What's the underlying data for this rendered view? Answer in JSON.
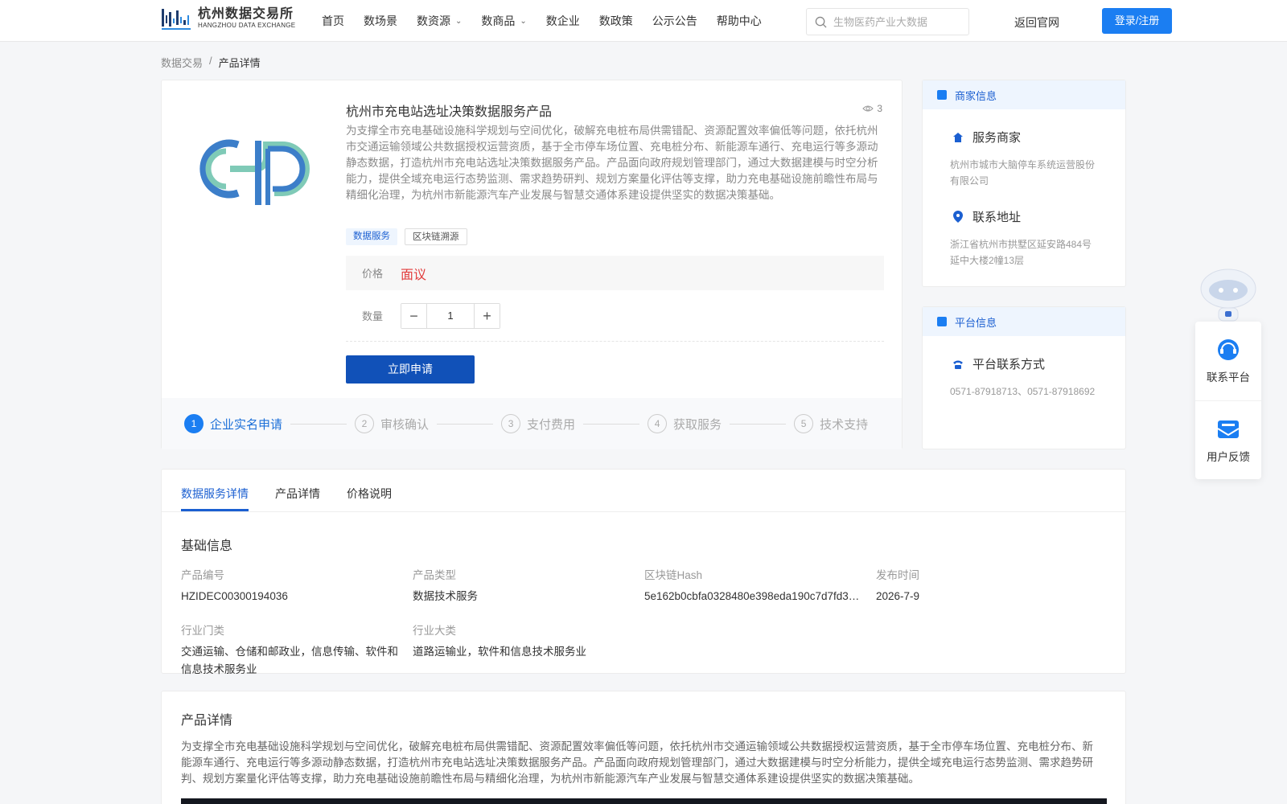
{
  "header": {
    "logo_cn": "杭州数据交易所",
    "logo_en": "HANGZHOU DATA EXCHANGE",
    "nav": [
      {
        "label": "首页",
        "dropdown": false
      },
      {
        "label": "数场景",
        "dropdown": false
      },
      {
        "label": "数资源",
        "dropdown": true
      },
      {
        "label": "数商品",
        "dropdown": true
      },
      {
        "label": "数企业",
        "dropdown": false
      },
      {
        "label": "数政策",
        "dropdown": false
      },
      {
        "label": "公示公告",
        "dropdown": false
      },
      {
        "label": "帮助中心",
        "dropdown": false
      }
    ],
    "search_placeholder": "生物医药产业大数据",
    "back_site": "返回官网",
    "login": "登录/注册"
  },
  "breadcrumb": {
    "root": "数据交易",
    "sep": "/",
    "current": "产品详情"
  },
  "product": {
    "title": "杭州市充电站选址决策数据服务产品",
    "views": "3",
    "description": "为支撑全市充电基础设施科学规划与空间优化，破解充电桩布局供需错配、资源配置效率偏低等问题，依托杭州市交通运输领域公共数据授权运营资质，基于全市停车场位置、充电桩分布、新能源车通行、充电运行等多源动静态数据，打造杭州市充电站选址决策数据服务产品。产品面向政府规划管理部门，通过大数据建模与时空分析能力，提供全域充电运行态势监测、需求趋势研判、规划方案量化评估等支撑，助力充电基础设施前瞻性布局与精细化治理，为杭州市新能源汽车产业发展与智慧交通体系建设提供坚实的数据决策基础。",
    "tags": [
      "数据服务",
      "区块链溯源"
    ],
    "price_label": "价格",
    "price_value": "面议",
    "qty_label": "数量",
    "qty_value": "1",
    "apply": "立即申请",
    "steps": [
      {
        "num": "1",
        "label": "企业实名申请"
      },
      {
        "num": "2",
        "label": "审核确认"
      },
      {
        "num": "3",
        "label": "支付费用"
      },
      {
        "num": "4",
        "label": "获取服务"
      },
      {
        "num": "5",
        "label": "技术支持"
      }
    ],
    "active_step": 1
  },
  "merchant": {
    "head": "商家信息",
    "service_title": "服务商家",
    "service_value": "杭州市城市大脑停车系统运营股份有限公司",
    "address_title": "联系地址",
    "address_value": "浙江省杭州市拱墅区延安路484号延中大楼2幢13层"
  },
  "platform": {
    "head": "平台信息",
    "contact_title": "平台联系方式",
    "contact_value": "0571-87918713、0571-87918692"
  },
  "tabs": [
    "数据服务详情",
    "产品详情",
    "价格说明"
  ],
  "basic": {
    "title": "基础信息",
    "fields": [
      {
        "k": "产品编号",
        "v": "HZIDEC00300194036"
      },
      {
        "k": "产品类型",
        "v": "数据技术服务"
      },
      {
        "k": "区块链Hash",
        "v": "5e162b0cbfa0328480e398eda190c7d7fd3…"
      },
      {
        "k": "发布时间",
        "v": "2026-7-9"
      },
      {
        "k": "行业门类",
        "v": "交通运输、仓储和邮政业，信息传输、软件和信息技术服务业"
      },
      {
        "k": "行业大类",
        "v": "道路运输业，软件和信息技术服务业"
      }
    ]
  },
  "product_detail": {
    "title": "产品详情",
    "text": "为支撑全市充电基础设施科学规划与空间优化，破解充电桩布局供需错配、资源配置效率偏低等问题，依托杭州市交通运输领域公共数据授权运营资质，基于全市停车场位置、充电桩分布、新能源车通行、充电运行等多源动静态数据，打造杭州市充电站选址决策数据服务产品。产品面向政府规划管理部门，通过大数据建模与时空分析能力，提供全域充电运行态势监测、需求趋势研判、规划方案量化评估等支撑，助力充电基础设施前瞻性布局与精细化治理，为杭州市新能源汽车产业发展与智慧交通体系建设提供坚实的数据决策基础。"
  },
  "float": {
    "contact": "联系平台",
    "feedback": "用户反馈"
  },
  "colors": {
    "primary": "#1b7ef2",
    "dark_primary": "#1151b8",
    "price": "#e23c3c"
  }
}
